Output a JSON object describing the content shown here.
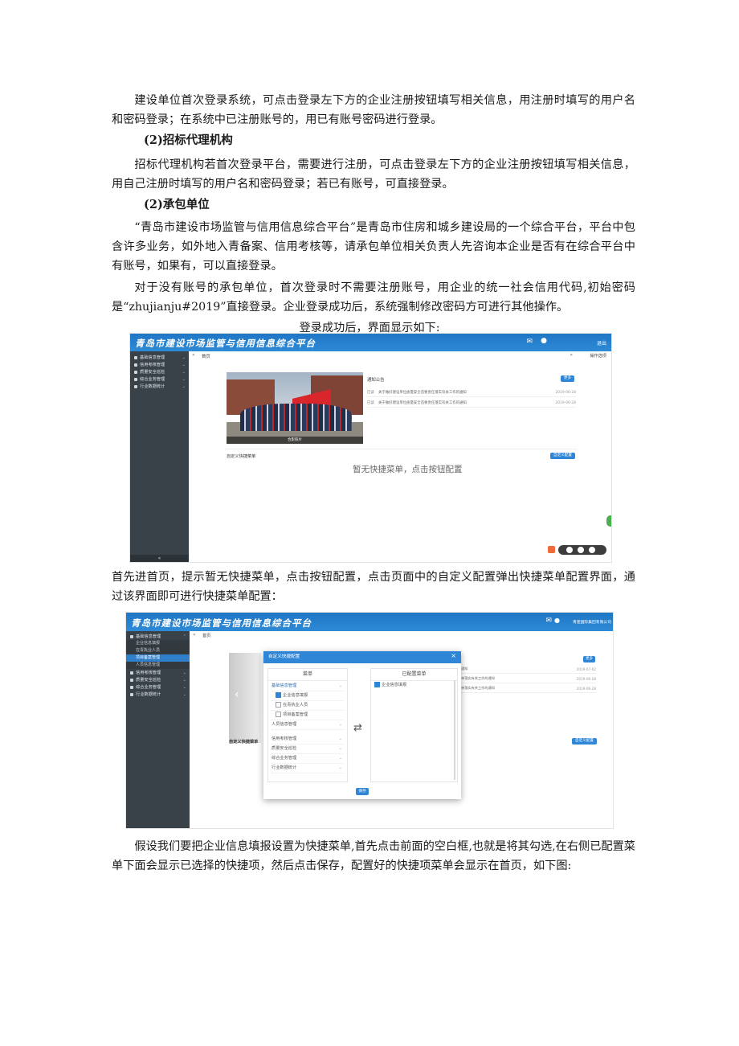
{
  "doc": {
    "p1": "建设单位首次登录系统，可点击登录左下方的企业注册按钮填写相关信息，用注册时填写的用户名和密码登录；在系统中已注册账号的，用已有账号密码进行登录。",
    "h_agency": "(2)招标代理机构",
    "p2": "招标代理机构若首次登录平台，需要进行注册，可点击登录左下方的企业注册按钮填写相关信息，用自己注册时填写的用户名和密码登录；若已有账号，可直接登录。",
    "h_contractor": "(2)承包单位",
    "p3": "“青岛市建设市场监管与信用信息综合平台”是青岛市住房和城乡建设局的一个综合平台，平台中包含许多业务，如外地入青备案、信用考核等，请承包单位相关负责人先咨询本企业是否有在综合平台中有账号，如果有，可以直接登录。",
    "p4": "对于没有账号的承包单位，首次登录时不需要注册账号，用企业的统一社会信用代码,初始密码是“zhujianju#2019”直接登录。企业登录成功后，系统强制修改密码方可进行其他操作。",
    "caption": "登录成功后，界面显示如下:",
    "p5": "首先进首页，提示暂无快捷菜单，点击按钮配置，点击页面中的自定义配置弹出快捷菜单配置界面，通过该界面即可进行快捷菜单配置：",
    "p6": "假设我们要把企业信息填报设置为快捷菜单,首先点击前面的空白框,也就是将其勾选,在右侧已配置菜单下面会显示已选择的快捷项，然后点击保存，配置好的快捷项菜单会显示在首页，如下图:"
  },
  "shot1": {
    "brand": "青岛市建设市场监管与信用信息综合平台",
    "logout": "退出",
    "tab": "首页",
    "tab_ops": "操作选项",
    "sidebar": [
      "基础信息管理",
      "信用考核管理",
      "质量安全巡检",
      "综合业务管理",
      "行业数据统计"
    ],
    "sidebar_collapse": "«",
    "photo_caption": "合影照片",
    "notice_title": "通知公告",
    "more": "更多",
    "notices": [
      {
        "tag": "已读",
        "title": "关于做好建设单位质量安全首要责任落实有关工作的通知",
        "date": "2019-06-28"
      },
      {
        "tag": "已读",
        "title": "关于做好建设单位质量安全首要责任落实有关工作的通知",
        "date": "2019-06-28"
      }
    ],
    "quick_title": "自定义快捷菜单",
    "custom_btn": "自定义配置",
    "empty_msg": "暂无快捷菜单，点击按钮配置",
    "colors": {
      "topbar": "#2d8ad6",
      "sidebar": "#3a4249",
      "accent": "#2f86d6"
    }
  },
  "shot2": {
    "brand": "青岛市建设市场监管与信用信息综合平台",
    "user": "青建国际集团有限公司",
    "tab": "首页",
    "sidebar_head": "基础信息管理",
    "sidebar_subs": [
      "企业信息填报",
      "在青执业人员",
      "项目备案管理",
      "人员信息管理"
    ],
    "sidebar_rest": [
      "信用考核管理",
      "质量安全巡检",
      "综合业务管理",
      "行业数据统计"
    ],
    "more": "更多",
    "notice_dates": [
      "2019-07-02",
      "2019-06-28",
      "2019-06-28"
    ],
    "notice_titles": [
      "通知",
      "单落实有关工作的通知",
      "单落实有关工作的通知"
    ],
    "quick_title": "自定义快捷菜单",
    "custom_btn": "自定义配置",
    "modal": {
      "title": "自定义快捷配置",
      "close": "×",
      "left_col": "菜单",
      "right_col": "已配置菜单",
      "tree": [
        {
          "label": "基础信息管理",
          "kind": "group"
        },
        {
          "label": "企业信息填报",
          "kind": "check",
          "checked": true
        },
        {
          "label": "在青执业人员",
          "kind": "check",
          "checked": false
        },
        {
          "label": "项目备案管理",
          "kind": "check",
          "checked": false
        },
        {
          "label": "人员信息管理",
          "kind": "group"
        },
        {
          "label": "信用考核管理",
          "kind": "group"
        },
        {
          "label": "质量安全巡检",
          "kind": "group"
        },
        {
          "label": "综合业务管理",
          "kind": "group"
        },
        {
          "label": "行业数据统计",
          "kind": "group"
        }
      ],
      "configured": [
        "企业信息填报"
      ],
      "transfer": "⇄",
      "save": "保存"
    }
  }
}
